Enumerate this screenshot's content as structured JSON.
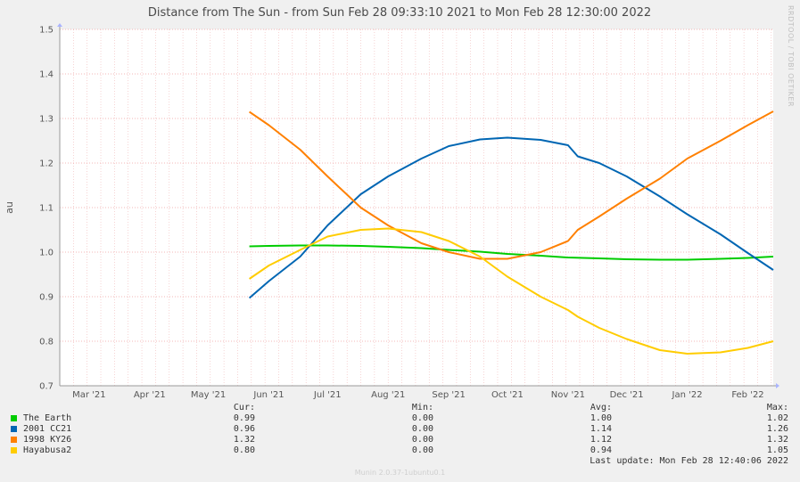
{
  "chart_data": {
    "type": "line",
    "title": "Distance from The Sun - from Sun Feb 28 09:33:10 2021 to Mon Feb 28 12:30:00 2022",
    "ylabel": "au",
    "watermark": "RRDTOOL / TOBI OETIKER",
    "ylim": [
      0.7,
      1.5
    ],
    "yticks": [
      "0.7",
      "0.8",
      "0.9",
      "1.0",
      "1.1",
      "1.2",
      "1.3",
      "1.4",
      "1.5"
    ],
    "xlim": [
      "2021-02-28",
      "2022-02-28"
    ],
    "xticks": [
      {
        "date": "2021-03-15",
        "label": "Mar '21"
      },
      {
        "date": "2021-04-15",
        "label": "Apr '21"
      },
      {
        "date": "2021-05-15",
        "label": "May '21"
      },
      {
        "date": "2021-06-15",
        "label": "Jun '21"
      },
      {
        "date": "2021-07-15",
        "label": "Jul '21"
      },
      {
        "date": "2021-08-15",
        "label": "Aug '21"
      },
      {
        "date": "2021-09-15",
        "label": "Sep '21"
      },
      {
        "date": "2021-10-15",
        "label": "Oct '21"
      },
      {
        "date": "2021-11-15",
        "label": "Nov '21"
      },
      {
        "date": "2021-12-15",
        "label": "Dec '21"
      },
      {
        "date": "2022-01-15",
        "label": "Jan '22"
      },
      {
        "date": "2022-02-15",
        "label": "Feb '22"
      }
    ],
    "grid": true,
    "series": [
      {
        "name": "The Earth",
        "color": "#00cc00",
        "x": [
          "2021-06-05",
          "2021-06-15",
          "2021-07-01",
          "2021-07-15",
          "2021-08-01",
          "2021-08-15",
          "2021-09-01",
          "2021-09-15",
          "2021-10-01",
          "2021-10-15",
          "2021-11-01",
          "2021-11-15",
          "2021-12-01",
          "2021-12-15",
          "2022-01-01",
          "2022-01-15",
          "2022-02-01",
          "2022-02-15",
          "2022-02-28"
        ],
        "values": [
          1.013,
          1.014,
          1.015,
          1.015,
          1.014,
          1.012,
          1.009,
          1.005,
          1.001,
          0.996,
          0.992,
          0.988,
          0.986,
          0.984,
          0.983,
          0.983,
          0.985,
          0.987,
          0.99
        ]
      },
      {
        "name": "2001 CC21",
        "color": "#0066b3",
        "x": [
          "2021-06-05",
          "2021-06-15",
          "2021-07-01",
          "2021-07-15",
          "2021-08-01",
          "2021-08-15",
          "2021-09-01",
          "2021-09-15",
          "2021-10-01",
          "2021-10-15",
          "2021-11-01",
          "2021-11-15",
          "2021-11-20",
          "2021-12-01",
          "2021-12-15",
          "2022-01-01",
          "2022-01-15",
          "2022-02-01",
          "2022-02-15",
          "2022-02-28"
        ],
        "values": [
          0.897,
          0.935,
          0.99,
          1.06,
          1.13,
          1.17,
          1.21,
          1.238,
          1.253,
          1.257,
          1.252,
          1.24,
          1.215,
          1.2,
          1.17,
          1.125,
          1.085,
          1.04,
          0.998,
          0.96
        ]
      },
      {
        "name": "1998 KY26",
        "color": "#ff8000",
        "x": [
          "2021-06-05",
          "2021-06-15",
          "2021-07-01",
          "2021-07-15",
          "2021-08-01",
          "2021-08-15",
          "2021-09-01",
          "2021-09-15",
          "2021-10-01",
          "2021-10-15",
          "2021-11-01",
          "2021-11-15",
          "2021-11-20",
          "2021-12-01",
          "2021-12-15",
          "2022-01-01",
          "2022-01-15",
          "2022-02-01",
          "2022-02-15",
          "2022-02-28"
        ],
        "values": [
          1.315,
          1.285,
          1.23,
          1.17,
          1.1,
          1.06,
          1.02,
          1.0,
          0.985,
          0.985,
          1.0,
          1.025,
          1.05,
          1.08,
          1.12,
          1.165,
          1.21,
          1.25,
          1.285,
          1.316
        ]
      },
      {
        "name": "Hayabusa2",
        "color": "#ffcc00",
        "x": [
          "2021-06-05",
          "2021-06-15",
          "2021-07-01",
          "2021-07-15",
          "2021-08-01",
          "2021-08-15",
          "2021-09-01",
          "2021-09-15",
          "2021-10-01",
          "2021-10-15",
          "2021-11-01",
          "2021-11-15",
          "2021-11-20",
          "2021-12-01",
          "2021-12-15",
          "2022-01-01",
          "2022-01-15",
          "2022-02-01",
          "2022-02-15",
          "2022-02-28"
        ],
        "values": [
          0.94,
          0.97,
          1.005,
          1.035,
          1.05,
          1.053,
          1.045,
          1.025,
          0.99,
          0.945,
          0.9,
          0.87,
          0.855,
          0.83,
          0.805,
          0.78,
          0.772,
          0.775,
          0.785,
          0.8
        ]
      }
    ]
  },
  "legend": {
    "headers": {
      "cur": "Cur:",
      "min": "Min:",
      "avg": "Avg:",
      "max": "Max:"
    },
    "rows": [
      {
        "name": "The Earth",
        "color": "#00cc00",
        "cur": "0.99",
        "min": "0.00",
        "avg": "1.00",
        "max": "1.02"
      },
      {
        "name": "2001 CC21",
        "color": "#0066b3",
        "cur": "0.96",
        "min": "0.00",
        "avg": "1.14",
        "max": "1.26"
      },
      {
        "name": "1998 KY26",
        "color": "#ff8000",
        "cur": "1.32",
        "min": "0.00",
        "avg": "1.12",
        "max": "1.32"
      },
      {
        "name": "Hayabusa2",
        "color": "#ffcc00",
        "cur": "0.80",
        "min": "0.00",
        "avg": "0.94",
        "max": "1.05"
      }
    ],
    "last_update": "Last update: Mon Feb 28 12:40:06 2022"
  },
  "footer": "Munin 2.0.37-1ubuntu0.1"
}
